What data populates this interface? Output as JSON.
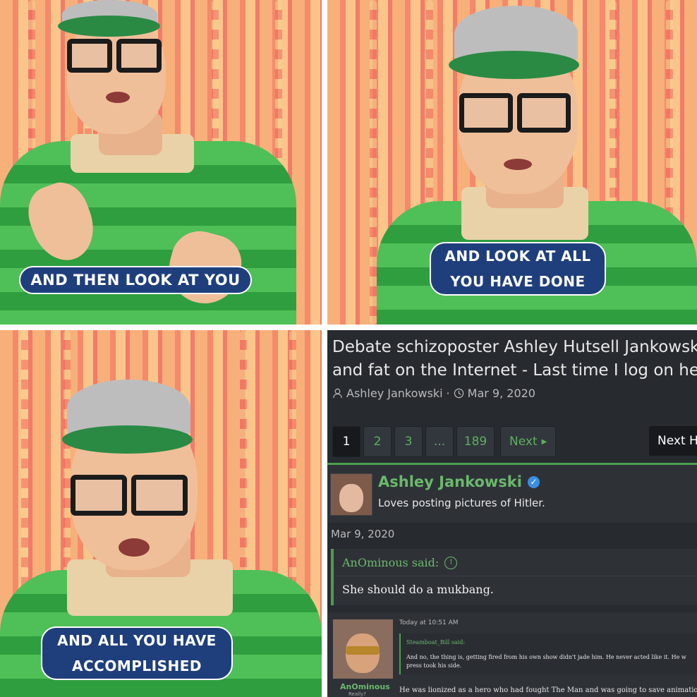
{
  "panels": {
    "panel1_caption": "AND THEN LOOK AT YOU",
    "panel2_caption_line1": "AND LOOK AT ALL",
    "panel2_caption_line2": "YOU HAVE DONE",
    "panel3_caption_line1": "AND ALL YOU HAVE",
    "panel3_caption_line2": "ACCOMPLISHED"
  },
  "forum": {
    "title_line1": "Debate schizoposter Ashley Hutsell Jankowski",
    "title_line2": "and fat on the Internet - Last time I log on here",
    "author": "Ashley Jankowski",
    "separator": "·",
    "date": "Mar 9, 2020",
    "pager": {
      "pages": [
        "1",
        "2",
        "3",
        "...",
        "189"
      ],
      "next": "Next",
      "next_thread": "Next H"
    },
    "post": {
      "username": "Ashley Jankowski",
      "tagline": "Loves posting pictures of Hitler.",
      "date": "Mar 9, 2020",
      "quote_author": "AnOminous said:",
      "quote_text": "She should do a mukbang."
    },
    "post2": {
      "username": "AnOminous",
      "user_sub": "Really?",
      "time": "Today at 10:51 AM",
      "quote_author": "Steamboat_Bill said:",
      "quote_line1": "And no, the thing is, getting fired from his own show didn't jade him. He never acted like it. He w",
      "quote_line2": "press took his side.",
      "body": "He was lionized as a hero who had fought The Man and was going to save animation."
    }
  },
  "colors": {
    "caption_bg": "#1f3f7c",
    "forum_bg": "#272b30",
    "accent_green": "#6bb86b"
  }
}
